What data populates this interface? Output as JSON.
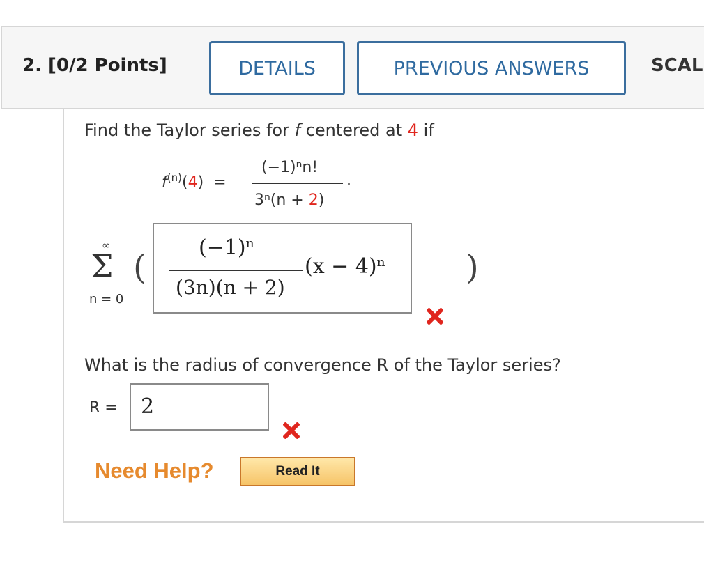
{
  "header": {
    "question_label": "2. [0/2 Points]",
    "details_label": "DETAILS",
    "previous_answers_label": "PREVIOUS ANSWERS",
    "scalar_label": "SCAL"
  },
  "problem": {
    "intro_before": "Find the Taylor series for ",
    "f_symbol": "f",
    "intro_middle": " centered at ",
    "center": "4",
    "intro_after": " if",
    "lhs_f": "f",
    "lhs_sup": "(n)",
    "lhs_arg": "4",
    "numerator": "(−1)ⁿn!",
    "denominator_prefix": "3ⁿ(n + ",
    "denominator_red": "2",
    "denominator_suffix": ")"
  },
  "series": {
    "sum_top": "∞",
    "sum_bottom": "n = 0",
    "open_paren": "(",
    "close_paren": ")",
    "answer_numerator": "(−1)ⁿ",
    "answer_denominator": "(3n)(n + 2)",
    "answer_factor": "(x − 4)ⁿ",
    "status": "incorrect"
  },
  "radius": {
    "question": "What is the radius of convergence R of the Taylor series?",
    "label": "R =",
    "value": "2",
    "status": "incorrect"
  },
  "help": {
    "need_help": "Need Help?",
    "read_it": "Read It"
  },
  "colors": {
    "accent_blue": "#2f6aa0",
    "error_red": "#e0261e",
    "help_orange": "#e68a2e"
  }
}
